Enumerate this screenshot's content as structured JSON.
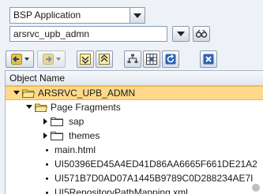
{
  "selector": {
    "object_type": "BSP Application",
    "object_name": "arsrvc_upb_admn"
  },
  "tree": {
    "column_header": "Object Name",
    "root": "ARSRVC_UPB_ADMN",
    "folder": "Page Fragments",
    "subfolders": [
      "sap",
      "themes"
    ],
    "files": [
      "main.html",
      "UI50396ED45A4ED41D86AA6665F661DE21A2",
      "UI571B7D0AD07A1445B9789C0D288234AE7I",
      "UI5RepositoryPathMapping.xml"
    ]
  },
  "icons": {
    "back": "back-arrow-icon",
    "forward": "forward-arrow-icon",
    "collapse": "collapse-icon",
    "expand": "expand-icon",
    "hierarchy": "hierarchy-icon",
    "grid": "grid-icon",
    "refresh": "refresh-icon",
    "close": "close-icon",
    "display": "glasses-icon"
  },
  "colors": {
    "selection": "#ffd98a",
    "folder": "#e8b84a",
    "toolbar_blue": "#2d62b5",
    "background": "#eef2f6"
  }
}
